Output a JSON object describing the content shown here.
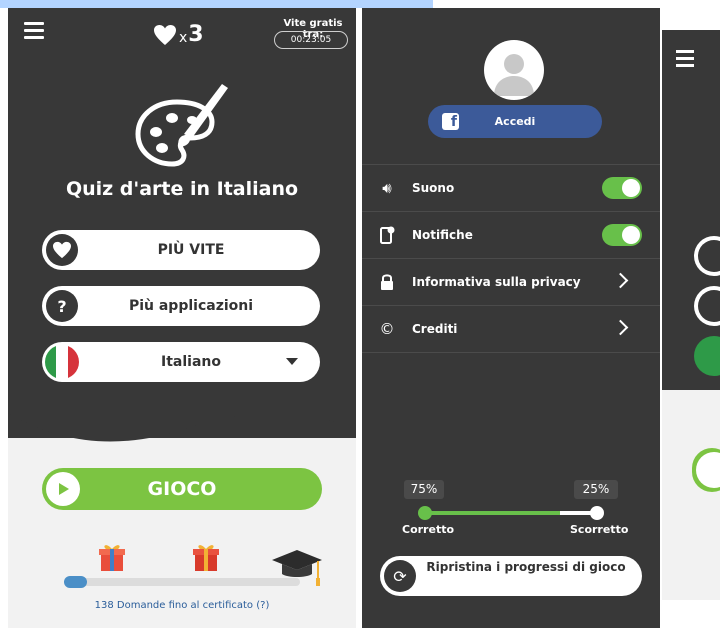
{
  "left": {
    "lives_x": "x",
    "lives_count": "3",
    "free_lives_label": "Vite gratis tra:",
    "free_lives_timer": "00:23:05",
    "app_title": "Quiz d'arte in Italiano",
    "more_lives_label": "PIÙ VITE",
    "more_apps_label": "Più applicazioni",
    "language_label": "Italiano",
    "play_label": "GIOCO",
    "progress_fraction": 0.1,
    "progress_text": "138 Domande fino al certificato (?)"
  },
  "menu": {
    "facebook_login_label": "Accedi",
    "items": [
      {
        "label": "Suono",
        "icon": "speaker-icon",
        "type": "toggle",
        "on": true
      },
      {
        "label": "Notifiche",
        "icon": "phone-notification-icon",
        "type": "toggle",
        "on": true
      },
      {
        "label": "Informativa sulla privacy",
        "icon": "lock-icon",
        "type": "link"
      },
      {
        "label": "Crediti",
        "icon": "copyright-icon",
        "type": "link"
      }
    ],
    "correct_pct": "75%",
    "wrong_pct": "25%",
    "correct_label": "Corretto",
    "wrong_label": "Scorretto",
    "reset_label": "Ripristina i progressi di gioco"
  },
  "colors": {
    "dark": "#383838",
    "green": "#7cc442",
    "toggle_green": "#68c04a",
    "facebook": "#3c5a99",
    "progress_blue": "#4b8fc7"
  }
}
